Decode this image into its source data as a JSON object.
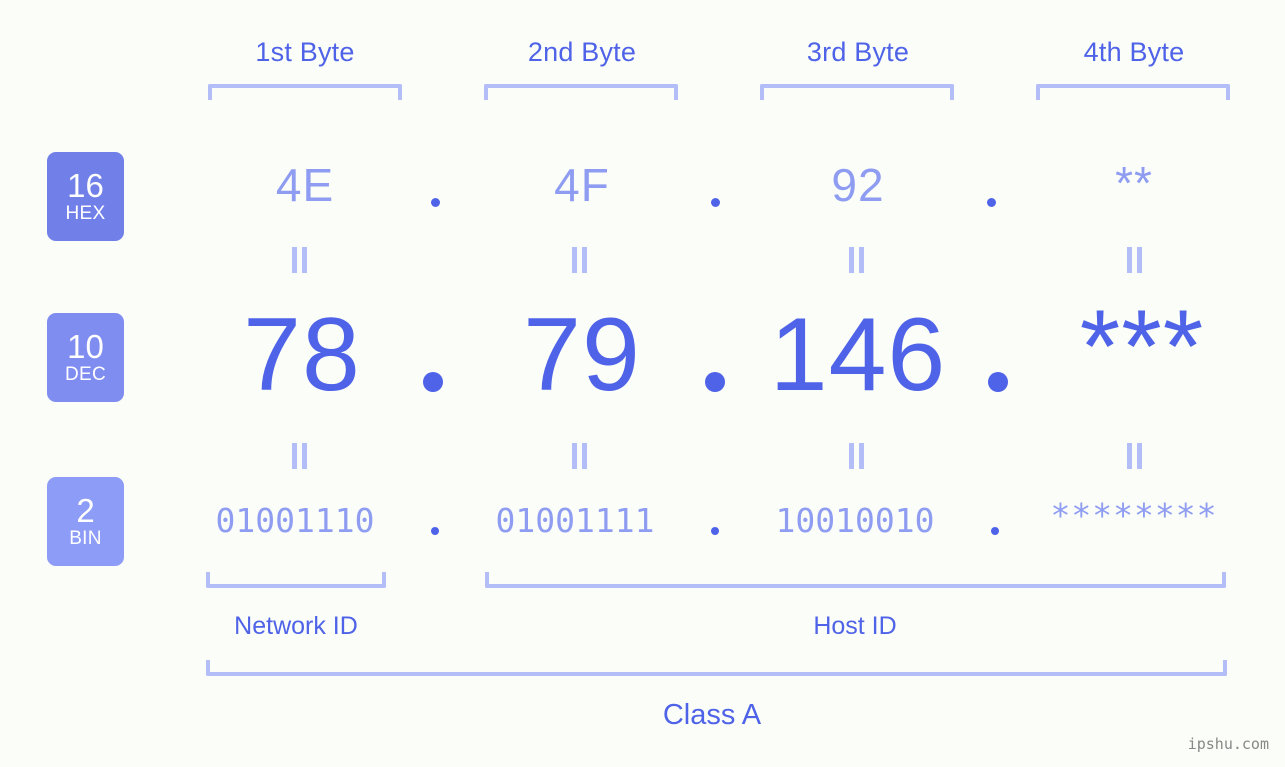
{
  "watermark": "ipshu.com",
  "byte_headers": [
    {
      "label": "1st Byte"
    },
    {
      "label": "2nd Byte"
    },
    {
      "label": "3rd Byte"
    },
    {
      "label": "4th Byte"
    }
  ],
  "bases": [
    {
      "num": "16",
      "abbr": "HEX"
    },
    {
      "num": "10",
      "abbr": "DEC"
    },
    {
      "num": "2",
      "abbr": "BIN"
    }
  ],
  "separator": ".",
  "equals": "=",
  "rows": {
    "hex": {
      "values": [
        "4E",
        "4F",
        "92",
        "**"
      ]
    },
    "dec": {
      "values": [
        "78",
        "79",
        "146",
        "***"
      ]
    },
    "bin": {
      "values": [
        "01001110",
        "01001111",
        "10010010",
        "********"
      ]
    }
  },
  "sections": {
    "network_id": "Network ID",
    "host_id": "Host ID",
    "class": "Class A"
  },
  "colors": {
    "background": "#fbfdf8",
    "accent_strong": "#4f63e8",
    "accent_soft": "#8e9cf2",
    "bracket": "#b3bdf7",
    "badge_hex": "#7080e8",
    "badge_dec": "#7f8df0",
    "badge_bin": "#8d9cf6",
    "watermark": "#888888"
  },
  "chart_data": {
    "type": "table",
    "title": "IP Address Byte Breakdown",
    "ip_address": "78.79.146.***",
    "ip_class": "Class A",
    "columns": [
      "1st Byte",
      "2nd Byte",
      "3rd Byte",
      "4th Byte"
    ],
    "rows": [
      {
        "base": "16",
        "name": "HEX",
        "values": [
          "4E",
          "4F",
          "92",
          "**"
        ]
      },
      {
        "base": "10",
        "name": "DEC",
        "values": [
          "78",
          "79",
          "146",
          "***"
        ]
      },
      {
        "base": "2",
        "name": "BIN",
        "values": [
          "01001110",
          "01001111",
          "10010010",
          "********"
        ]
      }
    ],
    "groupings": [
      {
        "label": "Network ID",
        "bytes": [
          1
        ]
      },
      {
        "label": "Host ID",
        "bytes": [
          2,
          3,
          4
        ]
      },
      {
        "label": "Class A",
        "bytes": [
          1,
          2,
          3,
          4
        ]
      }
    ]
  }
}
